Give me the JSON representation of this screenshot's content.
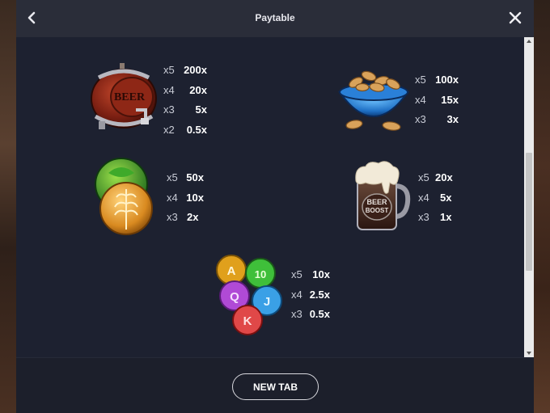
{
  "header": {
    "title": "Paytable"
  },
  "symbols": [
    {
      "name": "beer-barrel",
      "barrel_text": "BEER",
      "pays": [
        {
          "count": "x5",
          "value": "200x"
        },
        {
          "count": "x4",
          "value": "20x"
        },
        {
          "count": "x3",
          "value": "5x"
        },
        {
          "count": "x2",
          "value": "0.5x"
        }
      ]
    },
    {
      "name": "peanut-bowl",
      "pays": [
        {
          "count": "x5",
          "value": "100x"
        },
        {
          "count": "x4",
          "value": "15x"
        },
        {
          "count": "x3",
          "value": "3x"
        }
      ]
    },
    {
      "name": "hops-wheat-coin",
      "pays": [
        {
          "count": "x5",
          "value": "50x"
        },
        {
          "count": "x4",
          "value": "10x"
        },
        {
          "count": "x3",
          "value": "2x"
        }
      ]
    },
    {
      "name": "beer-mug",
      "mug_text_line1": "BEER",
      "mug_text_line2": "BOOST",
      "pays": [
        {
          "count": "x5",
          "value": "20x"
        },
        {
          "count": "x4",
          "value": "5x"
        },
        {
          "count": "x3",
          "value": "1x"
        }
      ]
    },
    {
      "name": "card-caps",
      "caps": [
        "A",
        "10",
        "Q",
        "J",
        "K"
      ],
      "pays": [
        {
          "count": "x5",
          "value": "10x"
        },
        {
          "count": "x4",
          "value": "2.5x"
        },
        {
          "count": "x3",
          "value": "0.5x"
        }
      ]
    }
  ],
  "footer": {
    "new_tab_label": "NEW TAB"
  },
  "colors": {
    "modal_bg": "#1c1f2b",
    "header_bg": "#2a2d39",
    "text": "#ffffff"
  }
}
